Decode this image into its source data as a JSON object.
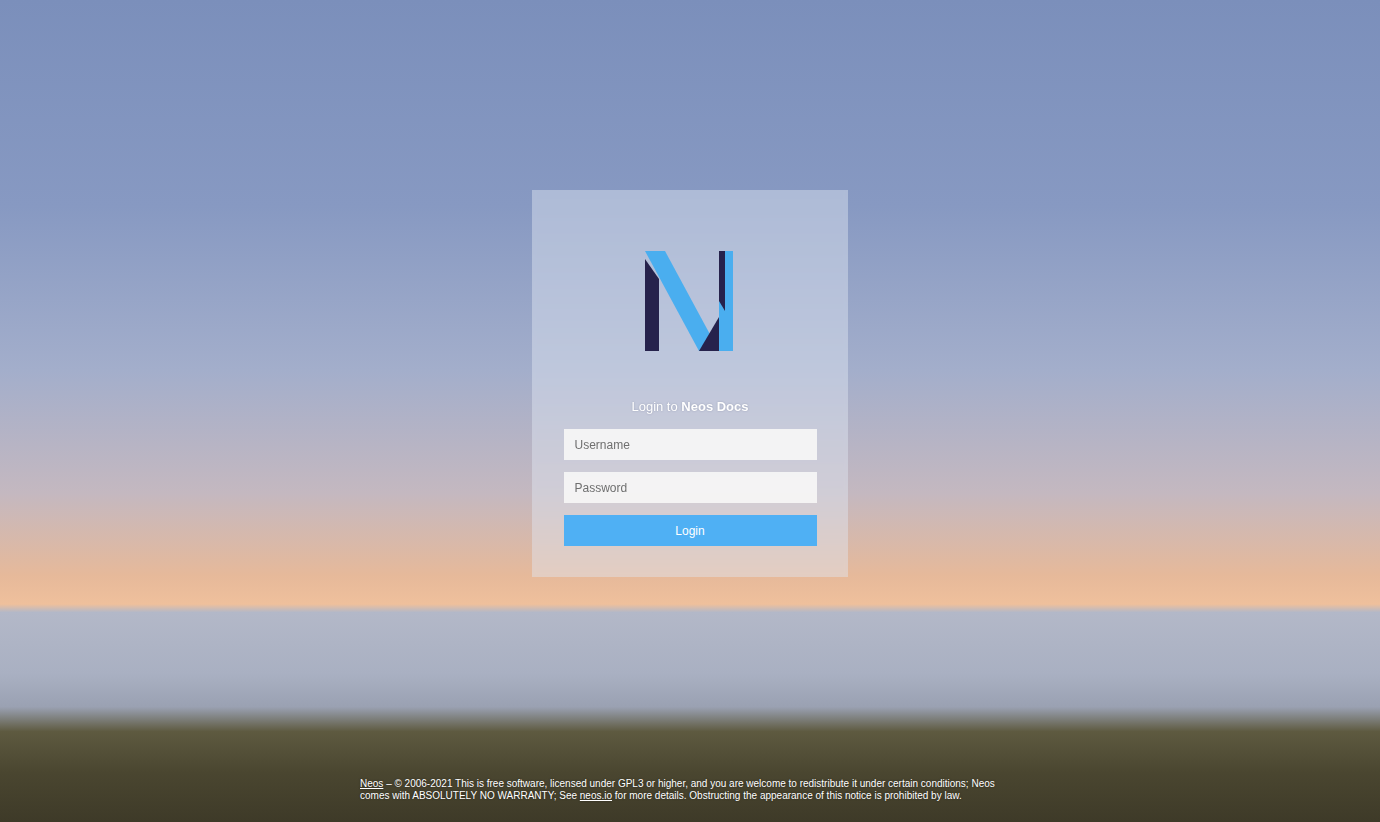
{
  "login": {
    "title": {
      "prefix": "Login to ",
      "site": "Neos Docs"
    },
    "fields": [
      {
        "placeholder": "Username",
        "kind": "text"
      },
      {
        "placeholder": "Password",
        "kind": "password"
      }
    ],
    "button": "Login"
  },
  "footer": [
    {
      "text": "Neos",
      "link": true
    },
    {
      "text": " –  © 2006-2021 This is free software, licensed under GPL3 or higher, and you are welcome to redistribute it under certain conditions;  Neos comes with ABSOLUTELY NO WARRANTY;  See ",
      "link": false
    },
    {
      "text": "neos.io",
      "link": true
    },
    {
      "text": " for more details. Obstructing the appearance of this notice is prohibited by law.",
      "link": false
    }
  ]
}
